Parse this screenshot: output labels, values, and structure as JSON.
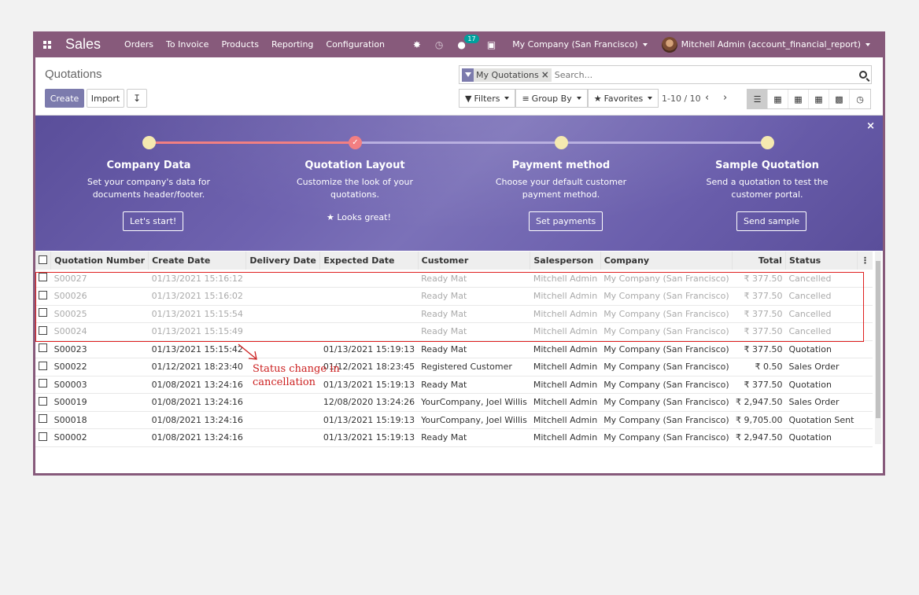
{
  "navbar": {
    "brand": "Sales",
    "menu": [
      "Orders",
      "To Invoice",
      "Products",
      "Reporting",
      "Configuration"
    ],
    "message_count": "17",
    "company": "My Company (San Francisco)",
    "user": "Mitchell Admin (account_financial_report)"
  },
  "control_panel": {
    "breadcrumb": "Quotations",
    "create_label": "Create",
    "import_label": "Import",
    "facet_label": "My Quotations",
    "search_placeholder": "Search...",
    "filters_label": "Filters",
    "groupby_label": "Group By",
    "favorites_label": "Favorites",
    "pager": "1-10 / 10"
  },
  "banner": {
    "steps": [
      {
        "title": "Company Data",
        "desc1": "Set your company's data for",
        "desc2": "documents header/footer.",
        "button": "Let's start!",
        "done": false
      },
      {
        "title": "Quotation Layout",
        "desc1": "Customize the look of your",
        "desc2": "quotations.",
        "button": "Looks great!",
        "done": true
      },
      {
        "title": "Payment method",
        "desc1": "Choose your default customer",
        "desc2": "payment method.",
        "button": "Set payments",
        "done": false
      },
      {
        "title": "Sample Quotation",
        "desc1": "Send a quotation to test the",
        "desc2": "customer portal.",
        "button": "Send sample",
        "done": false
      }
    ]
  },
  "table": {
    "columns": [
      "Quotation Number",
      "Create Date",
      "Delivery Date",
      "Expected Date",
      "Customer",
      "Salesperson",
      "Company",
      "Total",
      "Status"
    ],
    "rows": [
      {
        "number": "S00027",
        "create": "01/13/2021 15:16:12",
        "delivery": "",
        "expected": "",
        "customer": "Ready Mat",
        "salesperson": "Mitchell Admin",
        "company": "My Company (San Francisco)",
        "total": "₹ 377.50",
        "status": "Cancelled",
        "muted": true
      },
      {
        "number": "S00026",
        "create": "01/13/2021 15:16:02",
        "delivery": "",
        "expected": "",
        "customer": "Ready Mat",
        "salesperson": "Mitchell Admin",
        "company": "My Company (San Francisco)",
        "total": "₹ 377.50",
        "status": "Cancelled",
        "muted": true
      },
      {
        "number": "S00025",
        "create": "01/13/2021 15:15:54",
        "delivery": "",
        "expected": "",
        "customer": "Ready Mat",
        "salesperson": "Mitchell Admin",
        "company": "My Company (San Francisco)",
        "total": "₹ 377.50",
        "status": "Cancelled",
        "muted": true
      },
      {
        "number": "S00024",
        "create": "01/13/2021 15:15:49",
        "delivery": "",
        "expected": "",
        "customer": "Ready Mat",
        "salesperson": "Mitchell Admin",
        "company": "My Company (San Francisco)",
        "total": "₹ 377.50",
        "status": "Cancelled",
        "muted": true
      },
      {
        "number": "S00023",
        "create": "01/13/2021 15:15:42",
        "delivery": "",
        "expected": "01/13/2021 15:19:13",
        "customer": "Ready Mat",
        "salesperson": "Mitchell Admin",
        "company": "My Company (San Francisco)",
        "total": "₹ 377.50",
        "status": "Quotation",
        "muted": false
      },
      {
        "number": "S00022",
        "create": "01/12/2021 18:23:40",
        "delivery": "",
        "expected": "01/12/2021 18:23:45",
        "customer": "Registered Customer",
        "salesperson": "Mitchell Admin",
        "company": "My Company (San Francisco)",
        "total": "₹ 0.50",
        "status": "Sales Order",
        "muted": false
      },
      {
        "number": "S00003",
        "create": "01/08/2021 13:24:16",
        "delivery": "",
        "expected": "01/13/2021 15:19:13",
        "customer": "Ready Mat",
        "salesperson": "Mitchell Admin",
        "company": "My Company (San Francisco)",
        "total": "₹ 377.50",
        "status": "Quotation",
        "muted": false
      },
      {
        "number": "S00019",
        "create": "01/08/2021 13:24:16",
        "delivery": "",
        "expected": "12/08/2020 13:24:26",
        "customer": "YourCompany, Joel Willis",
        "salesperson": "Mitchell Admin",
        "company": "My Company (San Francisco)",
        "total": "₹ 2,947.50",
        "status": "Sales Order",
        "muted": false
      },
      {
        "number": "S00018",
        "create": "01/08/2021 13:24:16",
        "delivery": "",
        "expected": "01/13/2021 15:19:13",
        "customer": "YourCompany, Joel Willis",
        "salesperson": "Mitchell Admin",
        "company": "My Company (San Francisco)",
        "total": "₹ 9,705.00",
        "status": "Quotation Sent",
        "muted": false
      },
      {
        "number": "S00002",
        "create": "01/08/2021 13:24:16",
        "delivery": "",
        "expected": "01/13/2021 15:19:13",
        "customer": "Ready Mat",
        "salesperson": "Mitchell Admin",
        "company": "My Company (San Francisco)",
        "total": "₹ 2,947.50",
        "status": "Quotation",
        "muted": false
      }
    ]
  },
  "annotation": {
    "line1": "Status change in",
    "line2": "cancellation",
    "color": "#cc1f1f"
  },
  "colors": {
    "brand": "#875a7b",
    "primary_button": "#7c7bad",
    "banner": "#6a5eac",
    "progress_done": "#f27f82"
  }
}
